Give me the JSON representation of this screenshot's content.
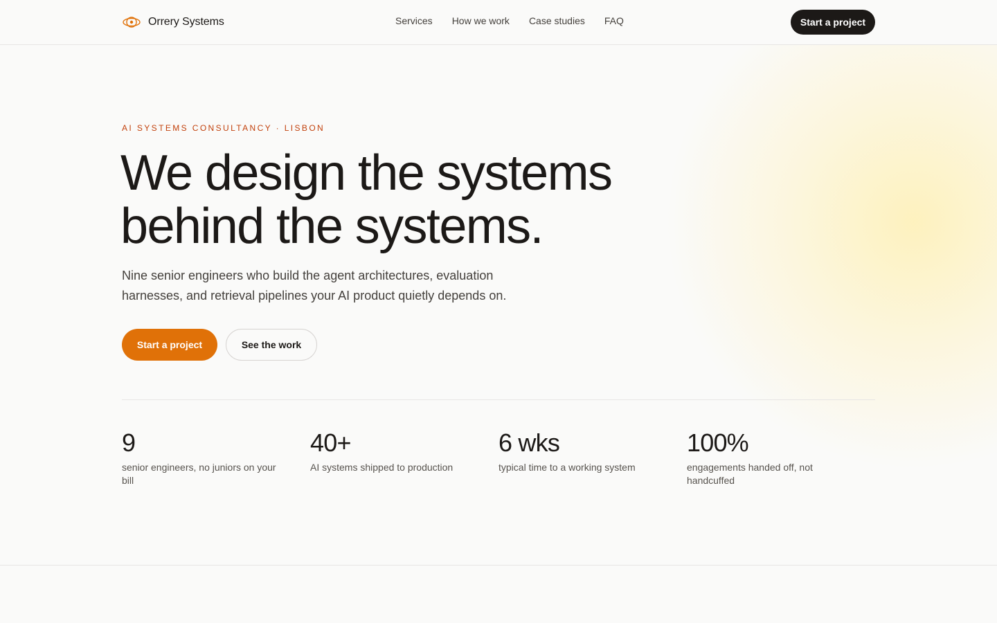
{
  "header": {
    "brand_name": "Orrery Systems",
    "brand_icon": "orbit-logo-icon",
    "nav": [
      "Services",
      "How we work",
      "Case studies",
      "FAQ"
    ],
    "cta_label": "Start a project"
  },
  "hero": {
    "eyebrow": "AI SYSTEMS CONSULTANCY · LISBON",
    "title_line1": "We design the systems",
    "title_line2": "behind the systems.",
    "lede_line1": "Nine senior engineers who build the agent architectures, evaluation",
    "lede_line2": "harnesses, and retrieval pipelines your AI product quietly depends on.",
    "primary_label": "Start a project",
    "secondary_label": "See the work"
  },
  "stats": [
    {
      "value": "9",
      "label": "senior engineers, no juniors on your bill"
    },
    {
      "value": "40+",
      "label": "AI systems shipped to production"
    },
    {
      "value": "6 wks",
      "label": "typical time to a working system"
    },
    {
      "value": "100%",
      "label": "engagements handed off, not handcuffed"
    }
  ],
  "colors": {
    "accent": "#e07108",
    "eyebrow": "#c2410c",
    "dark": "#1c1917",
    "background": "#fafaf9"
  }
}
